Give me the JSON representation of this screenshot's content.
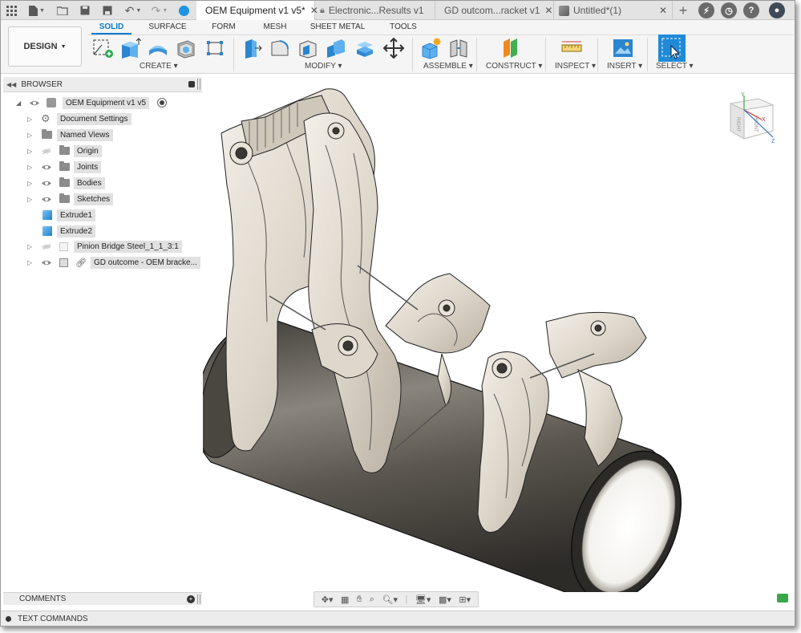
{
  "tabs": [
    {
      "label": "OEM Equipment v1 v5*",
      "active": true
    },
    {
      "label": "Electronic...Results v1",
      "active": false
    },
    {
      "label": "GD outcom...racket v1",
      "active": false
    },
    {
      "label": "Untitled*(1)",
      "active": false
    }
  ],
  "ribbon": {
    "design_button": "DESIGN",
    "tabs": [
      "SOLID",
      "SURFACE",
      "FORM",
      "MESH",
      "SHEET METAL",
      "TOOLS"
    ],
    "groups": [
      "CREATE",
      "MODIFY",
      "ASSEMBLE",
      "CONSTRUCT",
      "INSPECT",
      "INSERT",
      "SELECT"
    ]
  },
  "browser": {
    "title": "BROWSER",
    "root": "OEM Equipment v1 v5",
    "items": [
      "Document Settings",
      "Named Views",
      "Origin",
      "Joints",
      "Bodies",
      "Sketches",
      "Extrude1",
      "Extrude2",
      "Pinion Bridge Steel_1_1_3:1",
      "GD outcome - OEM bracke..."
    ]
  },
  "panels": {
    "comments": "COMMENTS",
    "text_commands": "TEXT COMMANDS"
  },
  "viewcube": {
    "face_right": "RIGHT",
    "face_front": "FRONT",
    "axis_x": "X",
    "axis_y": "Y",
    "axis_z": "Z"
  },
  "colors": {
    "accent": "#0a79c8",
    "model_surface": "#e6e0d6",
    "tube": "#5c5850"
  }
}
